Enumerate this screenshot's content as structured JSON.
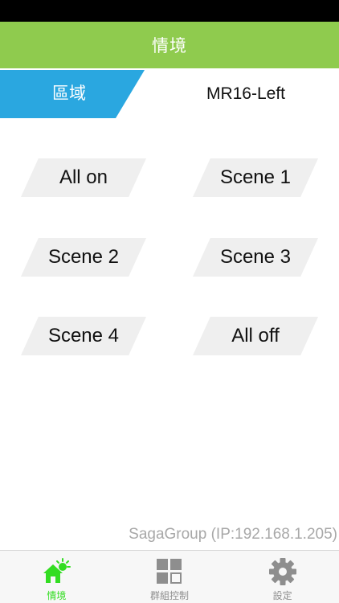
{
  "nav": {
    "title": "情境"
  },
  "zone": {
    "tab_label": "區域",
    "name": "MR16-Left"
  },
  "scenes": [
    {
      "label": "All on"
    },
    {
      "label": "Scene 1"
    },
    {
      "label": "Scene 2"
    },
    {
      "label": "Scene 3"
    },
    {
      "label": "Scene 4"
    },
    {
      "label": "All off"
    }
  ],
  "footer": {
    "ip_text": "SagaGroup (IP:192.168.1.205)"
  },
  "tabbar": {
    "items": [
      {
        "label": "情境",
        "icon": "house-lamp-icon",
        "active": true
      },
      {
        "label": "群組控制",
        "icon": "grid-icon",
        "active": false
      },
      {
        "label": "設定",
        "icon": "gear-icon",
        "active": false
      }
    ]
  },
  "colors": {
    "nav_bg": "#8fcb4e",
    "zone_tab_bg": "#2aa7e0",
    "scene_btn_bg": "#efefef",
    "tab_active": "#33dd22",
    "tab_inactive": "#8e8e8e",
    "footer_text": "#a8a8a8"
  }
}
